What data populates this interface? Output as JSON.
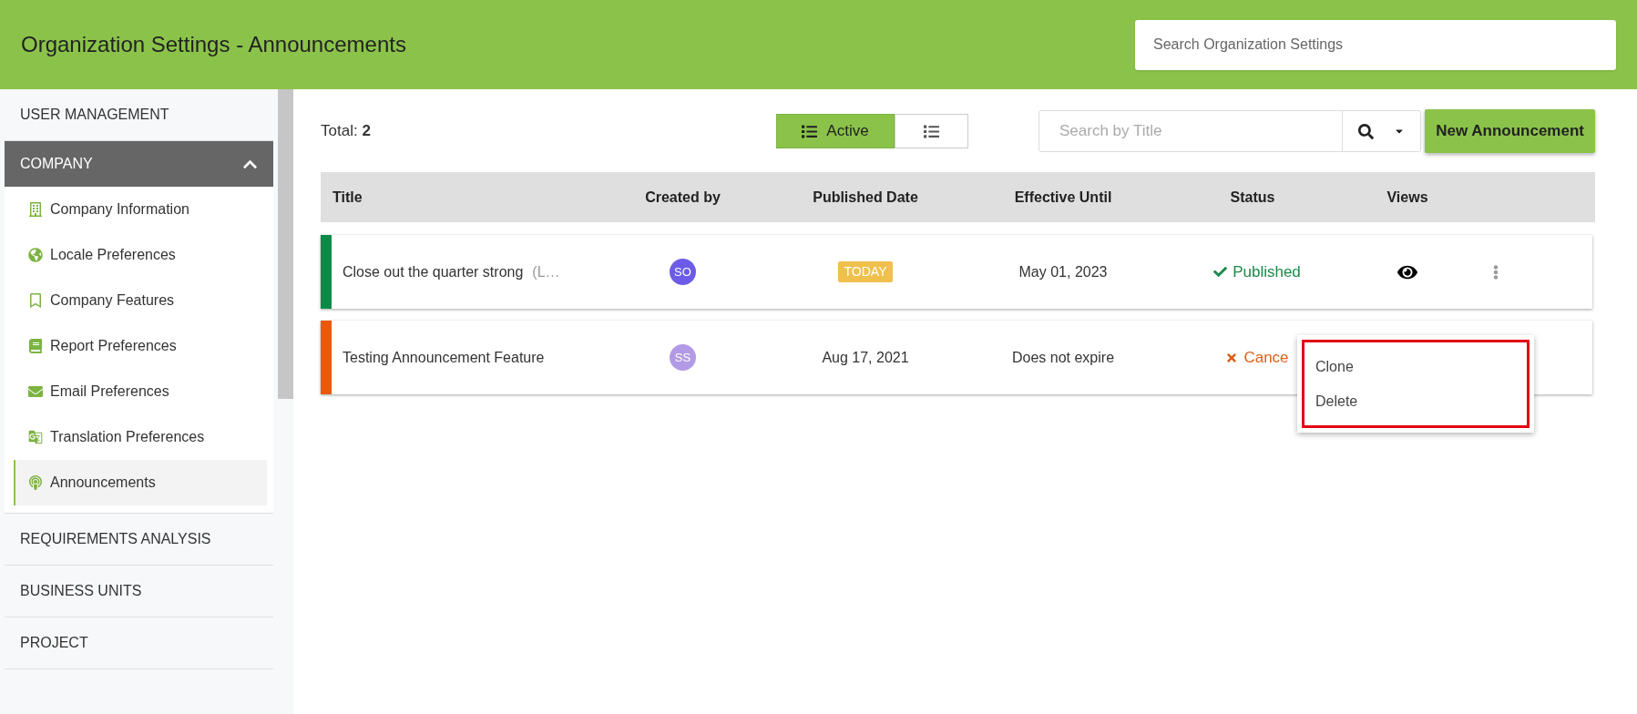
{
  "header": {
    "title": "Organization Settings - Announcements",
    "search": {
      "placeholder": "Search Organization Settings"
    }
  },
  "sidebar": {
    "sections": [
      {
        "label": "USER MANAGEMENT",
        "expanded": false
      },
      {
        "label": "COMPANY",
        "expanded": true,
        "children": [
          {
            "label": "Company Information",
            "selected": false
          },
          {
            "label": "Locale Preferences",
            "selected": false
          },
          {
            "label": "Company Features",
            "selected": false
          },
          {
            "label": "Report Preferences",
            "selected": false
          },
          {
            "label": "Email Preferences",
            "selected": false
          },
          {
            "label": "Translation Preferences",
            "selected": false
          },
          {
            "label": "Announcements",
            "selected": true
          }
        ]
      },
      {
        "label": "REQUIREMENTS ANALYSIS",
        "expanded": false
      },
      {
        "label": "BUSINESS UNITS",
        "expanded": false
      },
      {
        "label": "PROJECT",
        "expanded": false
      }
    ]
  },
  "toolbar": {
    "total_label": "Total:",
    "total": "2",
    "view_toggle": [
      {
        "label": "Active",
        "selected": true
      },
      {
        "selected": false
      }
    ],
    "search": {
      "placeholder": "Search by Title"
    },
    "new_button": "New Announcement"
  },
  "table": {
    "columns": [
      "Title",
      "Created by",
      "Published Date",
      "Effective Until",
      "Status",
      "Views"
    ],
    "rows": [
      {
        "color": "#0b8a47",
        "title": "Close out the quarter strong",
        "title_note": "(L…",
        "avatar": {
          "initials": "SO",
          "color": "#6c5ce7"
        },
        "published": {
          "kind": "badge",
          "text": "TODAY"
        },
        "effective_until": "May 01, 2023",
        "status": {
          "kind": "published",
          "text": "Published"
        },
        "menu_open": false
      },
      {
        "color": "#e8590c",
        "title": "Testing Announcement Feature",
        "avatar": {
          "initials": "SS",
          "color": "#b39ae6"
        },
        "published": {
          "kind": "text",
          "text": "Aug 17, 2021"
        },
        "effective_until": "Does not expire",
        "status": {
          "kind": "cancelled",
          "text": "Cance"
        },
        "menu_open": true
      }
    ]
  },
  "actions_menu": {
    "items": [
      "Clone",
      "Delete"
    ],
    "highlighted": true
  }
}
